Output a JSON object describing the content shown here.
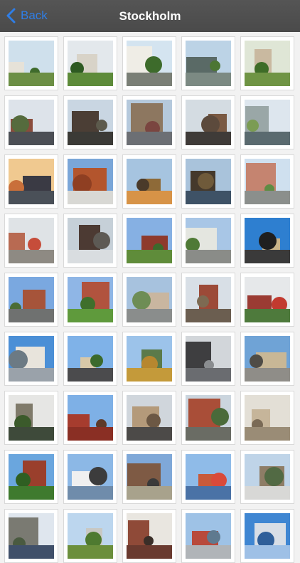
{
  "navbar": {
    "back_label": "Back",
    "title": "Stockholm"
  },
  "colors": {
    "navbar_bg": "#4f4f4f",
    "back_accent": "#2f7ee6",
    "page_bg": "#f2f2f2",
    "thumb_border": "#d9d9d9"
  },
  "photos": [
    {
      "sky": "#cfe0ec",
      "ground": "#6c8f45",
      "bldg": "#e6e2d8",
      "tree": "#3f6b2c"
    },
    {
      "sky": "#e3e8ec",
      "ground": "#5d8b3a",
      "bldg": "#d8d3c8",
      "tree": "#2e5a22"
    },
    {
      "sky": "#d4e4f0",
      "ground": "#7a7f76",
      "bldg": "#efede6",
      "tree": "#3d6b2b"
    },
    {
      "sky": "#bcd3e6",
      "ground": "#7c8a83",
      "bldg": "#5a6a66",
      "tree": "#4c7634"
    },
    {
      "sky": "#dfe6d6",
      "ground": "#6f9444",
      "bldg": "#c9b9a0",
      "tree": "#3e6c27"
    },
    {
      "sky": "#dde3ea",
      "ground": "#4c4f55",
      "bldg": "#8a4c3c",
      "tree": "#556b3d"
    },
    {
      "sky": "#c9d6e2",
      "ground": "#3b3a36",
      "bldg": "#4b3e35",
      "tree": "#5c5a4c"
    },
    {
      "sky": "#b5c9dc",
      "ground": "#6c6f74",
      "bldg": "#8d7760",
      "tree": "#7a4540"
    },
    {
      "sky": "#d4dce2",
      "ground": "#3f3b38",
      "bldg": "#7a5a43",
      "tree": "#5c4a3c"
    },
    {
      "sky": "#dde6ee",
      "ground": "#5a6a6f",
      "bldg": "#9aa7a7",
      "tree": "#7b9c54"
    },
    {
      "sky": "#f0c990",
      "ground": "#4a5058",
      "bldg": "#3a3a44",
      "tree": "#c96f3a"
    },
    {
      "sky": "#7aa6d8",
      "ground": "#d8d8d4",
      "bldg": "#b3552d",
      "tree": "#8f3f22"
    },
    {
      "sky": "#a6c4e0",
      "ground": "#d79347",
      "bldg": "#8e6a38",
      "tree": "#4a3a2a"
    },
    {
      "sky": "#a9c3db",
      "ground": "#3e5266",
      "bldg": "#45392c",
      "tree": "#6f5a3a"
    },
    {
      "sky": "#cfe0ef",
      "ground": "#8b8f8c",
      "bldg": "#c58470",
      "tree": "#5f8c44"
    },
    {
      "sky": "#dfe3e6",
      "ground": "#8e8a83",
      "bldg": "#b86a52",
      "tree": "#c64d3a"
    },
    {
      "sky": "#c6d0d8",
      "ground": "#d9dde0",
      "bldg": "#4c3a33",
      "tree": "#5d5a55"
    },
    {
      "sky": "#86b0e3",
      "ground": "#5f8c3a",
      "bldg": "#8e3a2d",
      "tree": "#3c6a2c"
    },
    {
      "sky": "#a8c6e6",
      "ground": "#8a8c88",
      "bldg": "#e4e6e0",
      "tree": "#4f7a36"
    },
    {
      "sky": "#2e7fd0",
      "ground": "#3a3a3a",
      "bldg": "#c9b48a",
      "tree": "#1f1f1f"
    },
    {
      "sky": "#7aa8e0",
      "ground": "#6f7170",
      "bldg": "#a6543a",
      "tree": "#4b6c35"
    },
    {
      "sky": "#8fb6e6",
      "ground": "#5f9a3c",
      "bldg": "#b1533e",
      "tree": "#3f6f2b"
    },
    {
      "sky": "#a7c2de",
      "ground": "#8a8d8c",
      "bldg": "#c9b6a0",
      "tree": "#6e8d55"
    },
    {
      "sky": "#d8dfe6",
      "ground": "#6b5e50",
      "bldg": "#9c4a38",
      "tree": "#7d6a52"
    },
    {
      "sky": "#e6e8ea",
      "ground": "#4e7a3c",
      "bldg": "#9b3b33",
      "tree": "#c23a2f"
    },
    {
      "sky": "#4b8fd6",
      "ground": "#9aa2aa",
      "bldg": "#e8e4dc",
      "tree": "#6c7a84"
    },
    {
      "sky": "#7fb2e8",
      "ground": "#4b4b4d",
      "bldg": "#d8c8a8",
      "tree": "#3b6a2c"
    },
    {
      "sky": "#9cc3ea",
      "ground": "#c49a3a",
      "bldg": "#5b7a4a",
      "tree": "#b7872f"
    },
    {
      "sky": "#d2d6da",
      "ground": "#6a6c70",
      "bldg": "#3e3e40",
      "tree": "#8a8d90"
    },
    {
      "sky": "#6fa3d6",
      "ground": "#8f8d88",
      "bldg": "#c8b796",
      "tree": "#4f4c46"
    },
    {
      "sky": "#e6e6e4",
      "ground": "#3e4a3a",
      "bldg": "#7f7a6a",
      "tree": "#3b5a2b"
    },
    {
      "sky": "#7eb0e6",
      "ground": "#8a2f24",
      "bldg": "#a63c2e",
      "tree": "#5d3a2a"
    },
    {
      "sky": "#d0d6dc",
      "ground": "#4c4a48",
      "bldg": "#b49a7a",
      "tree": "#6c5844"
    },
    {
      "sky": "#cbd5de",
      "ground": "#6a6c64",
      "bldg": "#a94e38",
      "tree": "#4a6a3a"
    },
    {
      "sky": "#e3dfd6",
      "ground": "#9a8c76",
      "bldg": "#c6b59a",
      "tree": "#7a6a56"
    },
    {
      "sky": "#6aa6de",
      "ground": "#3f7a2e",
      "bldg": "#9a3f2c",
      "tree": "#2f5f22"
    },
    {
      "sky": "#8cb8e6",
      "ground": "#6f8cab",
      "bldg": "#f0f0f0",
      "tree": "#3c3c3c"
    },
    {
      "sky": "#7fa8d8",
      "ground": "#a8a28c",
      "bldg": "#7e5a44",
      "tree": "#3a3a3a"
    },
    {
      "sky": "#8fbbe8",
      "ground": "#4a72a6",
      "bldg": "#c85a3a",
      "tree": "#d94a3a"
    },
    {
      "sky": "#bfd4e8",
      "ground": "#d8d8d6",
      "bldg": "#8e7d66",
      "tree": "#526a44"
    },
    {
      "sky": "#dfe6ee",
      "ground": "#40506a",
      "bldg": "#7a7a72",
      "tree": "#4a5a40"
    },
    {
      "sky": "#bcd6ee",
      "ground": "#6b8f3c",
      "bldg": "#c8c8c4",
      "tree": "#4e7a30"
    },
    {
      "sky": "#e9e6e0",
      "ground": "#6a3a2f",
      "bldg": "#8f4a38",
      "tree": "#3a2e28"
    },
    {
      "sky": "#9ec2e6",
      "ground": "#b0b4b8",
      "bldg": "#b84a3c",
      "tree": "#5f7a8f"
    },
    {
      "sky": "#3f86d2",
      "ground": "#9ec0e6",
      "bldg": "#d8dee6",
      "tree": "#2f5f9a"
    }
  ]
}
